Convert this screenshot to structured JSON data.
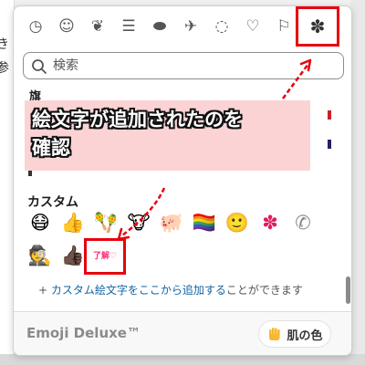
{
  "background": {
    "left_fragments": [
      "き",
      "参"
    ]
  },
  "category_bar": {
    "icons": [
      {
        "name": "clock-icon",
        "glyph": "◷"
      },
      {
        "name": "smiley-icon",
        "glyph": "☺"
      },
      {
        "name": "leaf-icon",
        "glyph": "❦"
      },
      {
        "name": "burger-icon",
        "glyph": "☰"
      },
      {
        "name": "football-icon",
        "glyph": "⬬"
      },
      {
        "name": "airplane-icon",
        "glyph": "✈"
      },
      {
        "name": "lightbulb-icon",
        "glyph": "◌"
      },
      {
        "name": "heart-icon",
        "glyph": "♡"
      },
      {
        "name": "flag-icon",
        "glyph": "⚐"
      },
      {
        "name": "slack-icon",
        "glyph": "✽"
      }
    ]
  },
  "search": {
    "placeholder": "検索"
  },
  "partial_section": {
    "heading": "旗"
  },
  "custom_section": {
    "title": "カスタム",
    "emojis": [
      {
        "name": "custom-emoji-masked-face",
        "glyph": "😷"
      },
      {
        "name": "custom-emoji-thumbs-up-gold",
        "glyph": "👍"
      },
      {
        "name": "custom-emoji-maracas",
        "glyph": "🪇"
      },
      {
        "name": "custom-emoji-cow-thumbs-up",
        "glyph": "🐮"
      },
      {
        "name": "custom-emoji-pig",
        "glyph": "🐖"
      },
      {
        "name": "custom-emoji-rainbow-flag",
        "glyph": "🏳️‍🌈"
      },
      {
        "name": "custom-emoji-smiley",
        "glyph": "🙂"
      },
      {
        "name": "custom-emoji-slack",
        "glyph": "✽"
      },
      {
        "name": "custom-emoji-phone",
        "glyph": "✆"
      },
      {
        "name": "custom-emoji-detective",
        "glyph": "🕵"
      },
      {
        "name": "custom-emoji-thumbs-up-dark",
        "glyph": "👍🏿"
      },
      {
        "name": "custom-emoji-ryokai",
        "glyph": "了解♡"
      }
    ]
  },
  "add_custom": {
    "plus": "+",
    "link_text": "カスタム絵文字をここから追加する",
    "rest_text": "ことができます"
  },
  "footer": {
    "brand": "Emoji Deluxe™",
    "skin_tone_label": "肌の色"
  },
  "annotation": {
    "line1": "絵文字が追加されたのを",
    "line2": "確認"
  },
  "colors": {
    "highlight_red": "#e8000b",
    "callout_background": "#fbd3d5",
    "link_blue": "#1264a3",
    "ryokai_pink": "#ff2d7a"
  }
}
